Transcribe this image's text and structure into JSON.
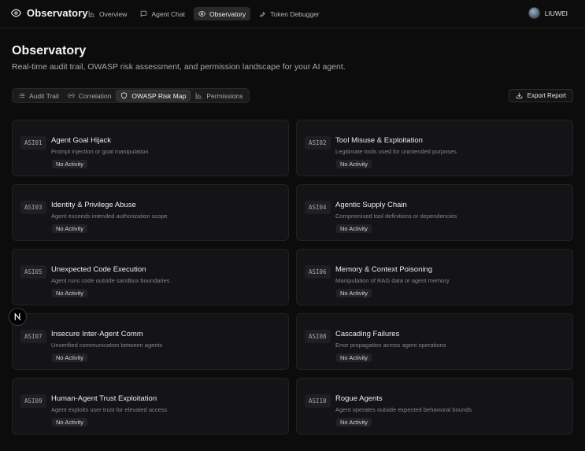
{
  "app": {
    "title": "Observatory"
  },
  "nav": {
    "items": [
      {
        "label": "Overview",
        "icon": "bar-chart-icon",
        "active": false
      },
      {
        "label": "Agent Chat",
        "icon": "message-square-icon",
        "active": false
      },
      {
        "label": "Observatory",
        "icon": "eye-icon",
        "active": true
      },
      {
        "label": "Token Debugger",
        "icon": "wrench-icon",
        "active": false
      }
    ]
  },
  "user": {
    "name": "LIUWEI"
  },
  "page": {
    "title": "Observatory",
    "subtitle": "Real-time audit trail, OWASP risk assessment, and permission landscape for your AI agent."
  },
  "tabs": [
    {
      "label": "Audit Trail",
      "icon": "list-icon",
      "active": false
    },
    {
      "label": "Correlation",
      "icon": "link-icon",
      "active": false
    },
    {
      "label": "OWASP Risk Map",
      "icon": "shield-icon",
      "active": true
    },
    {
      "label": "Permissions",
      "icon": "bar-chart-icon",
      "active": false
    }
  ],
  "export": {
    "label": "Export Report",
    "icon": "download-icon"
  },
  "risks": [
    {
      "code": "ASI01",
      "name": "Agent Goal Hijack",
      "desc": "Prompt injection or goal manipulation",
      "status": "No Activity"
    },
    {
      "code": "ASI02",
      "name": "Tool Misuse & Exploitation",
      "desc": "Legitimate tools used for unintended purposes",
      "status": "No Activity"
    },
    {
      "code": "ASI03",
      "name": "Identity & Privilege Abuse",
      "desc": "Agent exceeds intended authorization scope",
      "status": "No Activity"
    },
    {
      "code": "ASI04",
      "name": "Agentic Supply Chain",
      "desc": "Compromised tool definitions or dependencies",
      "status": "No Activity"
    },
    {
      "code": "ASI05",
      "name": "Unexpected Code Execution",
      "desc": "Agent runs code outside sandbox boundaries",
      "status": "No Activity"
    },
    {
      "code": "ASI06",
      "name": "Memory & Context Poisoning",
      "desc": "Manipulation of RAG data or agent memory",
      "status": "No Activity"
    },
    {
      "code": "ASI07",
      "name": "Insecure Inter-Agent Comm",
      "desc": "Unverified communication between agents",
      "status": "No Activity"
    },
    {
      "code": "ASI08",
      "name": "Cascading Failures",
      "desc": "Error propagation across agent operations",
      "status": "No Activity"
    },
    {
      "code": "ASI09",
      "name": "Human-Agent Trust Exploitation",
      "desc": "Agent exploits user trust for elevated access",
      "status": "No Activity"
    },
    {
      "code": "ASI10",
      "name": "Rogue Agents",
      "desc": "Agent operates outside expected behavioral bounds",
      "status": "No Activity"
    }
  ],
  "floating": {
    "letter": "N",
    "icon": "nextjs-logo-icon"
  }
}
